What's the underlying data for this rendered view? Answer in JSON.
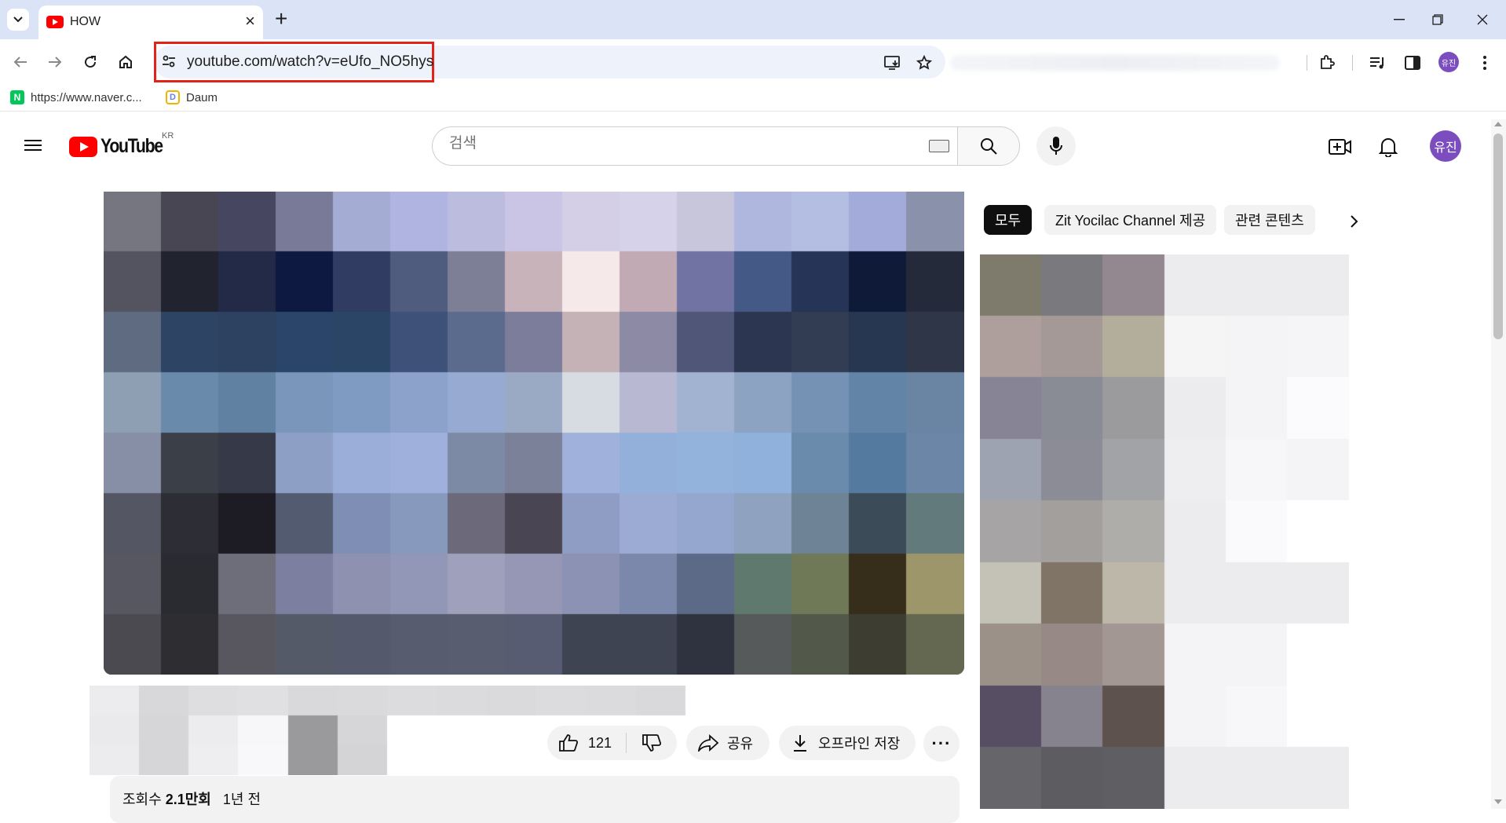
{
  "browser": {
    "tab_title": "HOW",
    "url": "youtube.com/watch?v=eUfo_NO5hys",
    "bookmarks": [
      {
        "label": "https://www.naver.c...",
        "icon": "naver-icon",
        "color": "#03c75a"
      },
      {
        "label": "Daum",
        "icon": "daum-icon",
        "color": "#6b7cf6"
      }
    ],
    "profile_initials": "유진",
    "highlight_color": "#e2231a"
  },
  "youtube": {
    "logo_text": "YouTube",
    "region": "KR",
    "search_placeholder": "검색",
    "avatar_initials": "유진",
    "likes": "121",
    "share_label": "공유",
    "download_label": "오프라인 저장",
    "more_label": "···",
    "views_label": "조회수",
    "views_value": "2.1만회",
    "date_label": "1년 전",
    "chips": [
      "모두",
      "Zit Yocilac Channel 제공",
      "관련 콘텐츠"
    ],
    "brand_color": "#ff0000"
  },
  "pixelated_video": {
    "cols": 15,
    "rows": 8,
    "grid": [
      [
        "#767681",
        "#474652",
        "#464660",
        "#787a98",
        "#a4acd4",
        "#b0b4e0",
        "#bcbcde",
        "#cac5e5",
        "#d4cfe7",
        "#d6d2e9",
        "#c8c6db",
        "#b0b7de",
        "#b4bde2",
        "#a2abd9",
        "#8a92ab"
      ],
      [
        "#545460",
        "#21232f",
        "#222a48",
        "#0d1940",
        "#313c63",
        "#4f5c7e",
        "#7d7f96",
        "#c8b3bb",
        "#f5e9ea",
        "#c2aab5",
        "#7174a2",
        "#445985",
        "#263458",
        "#0f1938",
        "#242a3a"
      ],
      [
        "#5f6b81",
        "#2d4465",
        "#2d4160",
        "#2a4569",
        "#2b4566",
        "#3e5279",
        "#5a6b8e",
        "#7b7d9a",
        "#c4b2b6",
        "#8c8aa4",
        "#4f5677",
        "#2c3650",
        "#323c52",
        "#273651",
        "#2e3647"
      ],
      [
        "#8e9eb3",
        "#6a8aac",
        "#6181a2",
        "#7a97bb",
        "#7f9bc1",
        "#8da2ca",
        "#97abd2",
        "#9aa9c4",
        "#d7dce3",
        "#b8b8d2",
        "#a2b3d1",
        "#8ca4c2",
        "#7592b4",
        "#6284a7",
        "#6a84a4"
      ],
      [
        "#878fa7",
        "#3b3f47",
        "#363a48",
        "#8e9fc6",
        "#9aaed9",
        "#9fb0dd",
        "#7d8aa5",
        "#7c819a",
        "#a0b2dc",
        "#93b0da",
        "#93b2dc",
        "#8fb1dc",
        "#6b8bad",
        "#547aa0",
        "#6b86a6"
      ],
      [
        "#545663",
        "#2c2d35",
        "#1d1c25",
        "#535b71",
        "#7f8eb4",
        "#8799bc",
        "#6c6a7a",
        "#4a4553",
        "#8f9dc5",
        "#9cabd3",
        "#96a7cf",
        "#8fa2bf",
        "#6e8396",
        "#3c4b58",
        "#637a7c"
      ],
      [
        "#575761",
        "#2a2a31",
        "#6e6e7a",
        "#7c7f9f",
        "#8e92b0",
        "#9297b7",
        "#9fa0bb",
        "#9597b4",
        "#8b92b3",
        "#7b88ab",
        "#5c6a87",
        "#5f796f",
        "#6f7857",
        "#362d1b",
        "#9e966b"
      ],
      [
        "#4a4a50",
        "#2e2e32",
        "#58575f",
        "#555a68",
        "#545a6b",
        "#575d6e",
        "#585d70",
        "#585c72",
        "#3f4452",
        "#3f4453",
        "#2f3340",
        "#575a5b",
        "#53594a",
        "#3d3d31",
        "#656850"
      ]
    ]
  },
  "pixelated_title": {
    "cols": 14,
    "rows": 3,
    "grid": [
      [
        "#ececee",
        "#d8d8da",
        "#dedee0",
        "#e0e0e2",
        "#d9d9db",
        "#dadadc",
        "#dcdcde",
        "#dbdbdd",
        "#dadadc",
        "#dcdcde",
        "#dbdbdd",
        "#d9d9db",
        "#ffffff",
        "#ffffff"
      ],
      [
        "#eaeaec",
        "#d6d6d8",
        "#ececee",
        "#f7f7f9",
        "#9a9a9c",
        "#d6d6d8",
        "#ffffff",
        "#ffffff",
        "#ffffff",
        "#ffffff",
        "#ffffff",
        "#ffffff",
        "#ffffff",
        "#ffffff"
      ],
      [
        "#ececee",
        "#d6d6d8",
        "#eeeef0",
        "#f8f8fa",
        "#9a9a9c",
        "#d4d4d6",
        "#ffffff",
        "#ffffff",
        "#ffffff",
        "#ffffff",
        "#ffffff",
        "#ffffff",
        "#ffffff",
        "#ffffff"
      ]
    ]
  },
  "pixelated_sidebar": {
    "cols": 6,
    "rows": 9,
    "grid": [
      [
        "#7f7b6c",
        "#7a797d",
        "#948890",
        "#ececee",
        "#ececee",
        "#ececee"
      ],
      [
        "#ae9f9c",
        "#a49996",
        "#b2ae9b",
        "#f5f5f5",
        "#f4f4f6",
        "#f5f5f7"
      ],
      [
        "#878496",
        "#898b95",
        "#9b9a9c",
        "#ececee",
        "#f4f4f6",
        "#fbfafc"
      ],
      [
        "#9ea3b1",
        "#8b8c96",
        "#a2a3a7",
        "#eeeef0",
        "#f7f7f9",
        "#f4f4f6"
      ],
      [
        "#a7a4a6",
        "#a29f9c",
        "#aeadaa",
        "#ececee",
        "#fafafc",
        "#ffffff"
      ],
      [
        "#c4c2b6",
        "#7f7466",
        "#bdb7a9",
        "#ececee",
        "#ececee",
        "#ececee"
      ],
      [
        "#9b9188",
        "#978a86",
        "#a39794",
        "#f4f4f6",
        "#f4f4f6",
        "#ffffff"
      ],
      [
        "#574e64",
        "#87838e",
        "#5d524e",
        "#f4f4f6",
        "#f7f7f9",
        "#ffffff"
      ],
      [
        "#66666a",
        "#5d5d61",
        "#5f5f63",
        "#ececee",
        "#ececee",
        "#ececee"
      ]
    ]
  }
}
